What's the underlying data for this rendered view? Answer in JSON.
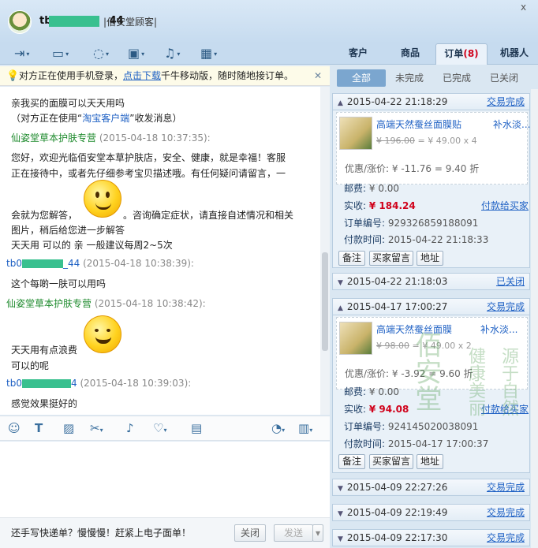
{
  "window": {
    "name_prefix": "tb0",
    "name_suffix": "44",
    "store": "|佰安堂顾客|",
    "close": "x"
  },
  "toolbar": {
    "icons": [
      "share-icon",
      "video-icon",
      "chat-bubble-icon",
      "screen-share-icon",
      "bell-icon",
      "calendar-add-icon"
    ],
    "arrow": "▾"
  },
  "right_tabs": {
    "customer": "客户",
    "goods": "商品",
    "order": "订单",
    "order_count": "(8)",
    "robot": "机器人"
  },
  "notice": {
    "text1": "对方正在使用手机登录，",
    "link": "点击下载",
    "text2": "千牛移动版，随时随地接订单。",
    "close": "✕"
  },
  "chat": {
    "m0": "亲我买的面膜可以天天用吗",
    "m0b": "（对方正在使用“",
    "m0c": "淘宝客户端",
    "m0d": "”收发消息）",
    "s1": "仙姿堂草本护肤专营",
    "t1": "(2015-04-18 10:37:35):",
    "m1a": "您好，欢迎光临佰安堂本草护肤店，安全、健康，就是幸福！客服",
    "m1b": "正在接待中，或者先仔细参考宝贝描述哦。有任何疑问请留言，一",
    "m1c": "会就为您解答，",
    "m1d": "。咨询确定症状，请直接自述情况和相关",
    "m1e": "图片，稍后给您进一步解答",
    "m1f": "天天用  可以的 亲    一般建议每周2~5次",
    "s2": "tb0",
    "s2b": "44",
    "t2": "(2015-04-18 10:38:39):",
    "m2": "这个每啲一肤可以用吗",
    "s3": "仙姿堂草本护肤专营",
    "t3": "(2015-04-18 10:38:42):",
    "m3a": "天天用有点浪费",
    "m3b": "可以的呢",
    "s4": "tb0",
    "s4b": "4",
    "t4": "(2015-04-18 10:39:03):",
    "m4": "感觉效果挺好的"
  },
  "chatbar": {
    "icons": [
      "emoji-icon",
      "font-icon",
      "image-icon",
      "scissors-icon",
      "shake-icon",
      "heart-icon",
      "keyboard-icon",
      "quick-reply-icon",
      "history-icon"
    ]
  },
  "bottom": {
    "tip": "还手写快递单？慢慢慢！赶紧上电子面单！",
    "close": "关闭",
    "send": "发送",
    "send_arrow": "▾"
  },
  "filters": {
    "all": "全部",
    "unfinished": "未完成",
    "finished": "已完成",
    "closed": "已关闭"
  },
  "orders": [
    {
      "date": "2015-04-22 21:18:29",
      "status": "交易完成",
      "name": "高端天然蚕丝面膜贴",
      "name_tail": "补水淡...",
      "price_orig": "¥ 196.00",
      "price_now": "= ¥ 49.00 x 4",
      "discount": "优惠/涨价: ¥ -11.76 = 9.40 折",
      "postage_k": "邮费:",
      "postage_v": "¥ 0.00",
      "paid_k": "实收:",
      "paid_v": "¥ 184.24",
      "pay_link": "付款给买家",
      "no_k": "订单编号:",
      "no_v": "929326859188091",
      "time_k": "付款时间:",
      "time_v": "2015-04-22 21:18:33",
      "b1": "备注",
      "b2": "买家留言",
      "b3": "地址"
    },
    {
      "date": "2015-04-22 21:18:03",
      "status": "已关闭"
    },
    {
      "date": "2015-04-17 17:00:27",
      "status": "交易完成",
      "name": "高端天然蚕丝面膜",
      "name_tail": "补水淡...",
      "price_orig": "¥ 98.00",
      "price_now": "= ¥ 49.00 x 2",
      "discount": "优惠/涨价: ¥ -3.92 = 9.60 折",
      "postage_k": "邮费:",
      "postage_v": "¥ 0.00",
      "paid_k": "实收:",
      "paid_v": "¥ 94.08",
      "pay_link": "付款给买家",
      "no_k": "订单编号:",
      "no_v": "924145020038091",
      "time_k": "付款时间:",
      "time_v": "2015-04-17 17:00:37",
      "b1": "备注",
      "b2": "买家留言",
      "b3": "地址"
    },
    {
      "date": "2015-04-09 22:27:26",
      "status": "交易完成"
    },
    {
      "date": "2015-04-09 22:19:49",
      "status": "交易完成"
    },
    {
      "date": "2015-04-09 22:17:30",
      "status": "交易完成"
    }
  ],
  "watermark": {
    "c1": "佰安堂",
    "c2": "健康美丽",
    "c3": "源于自然"
  },
  "colors": {
    "accent": "#1f61c4",
    "seller": "#1d8a2c",
    "price": "#d0021b",
    "mask": "#39c08f"
  }
}
